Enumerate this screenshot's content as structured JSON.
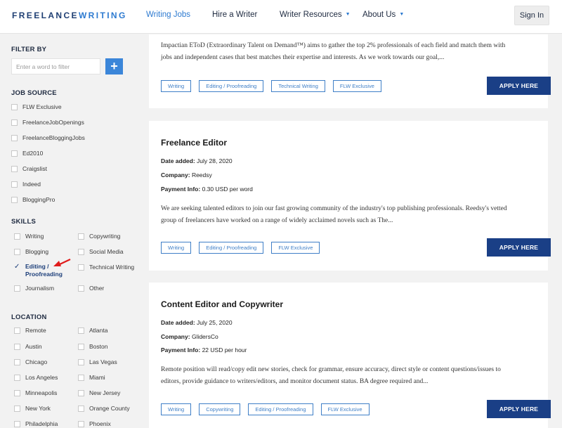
{
  "header": {
    "logo_part1": "FREELANCE",
    "logo_part2": "WRITING",
    "nav": [
      {
        "label": "Writing Jobs"
      },
      {
        "label": "Hire a Writer"
      },
      {
        "label": "Writer Resources"
      },
      {
        "label": "About Us"
      }
    ],
    "signin_label": "Sign In"
  },
  "sidebar": {
    "filter_title": "FILTER BY",
    "filter_placeholder": "Enter a word to filter",
    "filter_button": "+",
    "job_source_title": "JOB SOURCE",
    "job_sources": [
      "FLW Exclusive",
      "FreelanceJobOpenings",
      "FreelanceBloggingJobs",
      "Ed2010",
      "Craigslist",
      "Indeed",
      "BloggingPro"
    ],
    "skills_title": "SKILLS",
    "skills": [
      "Writing",
      "Copywriting",
      "Blogging",
      "Social Media",
      "Editing / Proofreading",
      "Technical Writing",
      "Journalism",
      "Other"
    ],
    "location_title": "LOCATION",
    "locations": [
      "Remote",
      "Atlanta",
      "Austin",
      "Boston",
      "Chicago",
      "Las Vegas",
      "Los Angeles",
      "Miami",
      "Minneapolis",
      "New Jersey",
      "New York",
      "Orange County",
      "Philadelphia",
      "Phoenix"
    ]
  },
  "jobs": [
    {
      "description": "Impactian EToD (Extraordinary Talent on Demand™) aims to gather the top 2% professionals of each field and match them with jobs and independent cases that best matches their expertise and interests. As we work towards our goal,...",
      "tags": [
        "Writing",
        "Editing / Proofreading",
        "Technical Writing",
        "FLW Exclusive"
      ],
      "apply_label": "APPLY HERE"
    },
    {
      "title": "Freelance Editor",
      "date_label": "Date added:",
      "date": "July 28, 2020",
      "company_label": "Company:",
      "company": "Reedsy",
      "payment_label": "Payment Info:",
      "payment": "0.30 USD per word",
      "description": "We are seeking talented editors to join our fast growing community of the industry's top publishing professionals. Reedsy's vetted group of freelancers have worked on a range of widely acclaimed novels such as The...",
      "tags": [
        "Writing",
        "Editing / Proofreading",
        "FLW Exclusive"
      ],
      "apply_label": "APPLY HERE"
    },
    {
      "title": "Content Editor and Copywriter",
      "date_label": "Date added:",
      "date": "July 25, 2020",
      "company_label": "Company:",
      "company": "GlidersCo",
      "payment_label": "Payment Info:",
      "payment": "22 USD per hour",
      "description": "Remote position will read/copy edit new stories, check for grammar, ensure accuracy, direct style or content questions/issues to editors, provide guidance to writers/editors, and monitor document status. BA degree required and...",
      "tags": [
        "Writing",
        "Copywriting",
        "Editing / Proofreading",
        "FLW Exclusive"
      ],
      "apply_label": "APPLY HERE"
    }
  ],
  "colors": {
    "brand_dark": "#1f3f73",
    "brand_light": "#2d7ad0",
    "apply_button": "#1a3f86",
    "annotation_arrow": "#e01b1b"
  }
}
